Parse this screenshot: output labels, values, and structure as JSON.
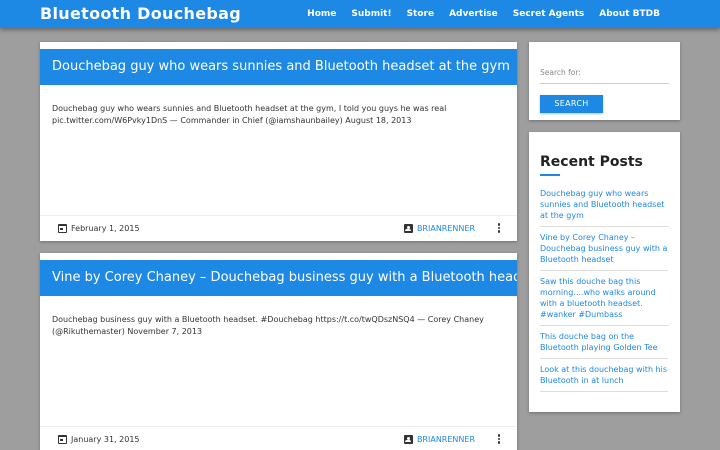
{
  "header": {
    "site_title": "Bluetooth Douchebag",
    "nav": [
      "Home",
      "Submit!",
      "Store",
      "Advertise",
      "Secret Agents",
      "About BTDB"
    ]
  },
  "posts": [
    {
      "title": "Douchebag guy who wears sunnies and Bluetooth headset at the gym",
      "body": "Douchebag guy who wears sunnies and Bluetooth headset at the gym, I told you guys he was real pic.twitter.com/W6Pvky1DnS — Commander in Chief (@iamshaunbailey) August 18, 2013",
      "date": "February 1, 2015",
      "author": "BRIANRENNER"
    },
    {
      "title": "Vine by Corey Chaney – Douchebag business guy with a Bluetooth headset",
      "body": "Douchebag business guy with a Bluetooth headset. #Douchebag https://t.co/twQDszNSQ4 — Corey Chaney (@Rikuthemaster) November 7, 2013",
      "date": "January 31, 2015",
      "author": "BRIANRENNER"
    }
  ],
  "sidebar": {
    "search": {
      "label": "Search for:",
      "button": "SEARCH"
    },
    "recent": {
      "title": "Recent Posts",
      "items": [
        "Douchebag guy who wears sunnies and Bluetooth headset at the gym",
        "Vine by Corey Chaney – Douchebag business guy with a Bluetooth headset",
        "Saw this douche bag this morning....who walks around with a bluetooth headset. #wanker #Dumbass",
        "This douche bag on the Bluetooth playing Golden Tee",
        "Look at this douchebag with his Bluetooth in at lunch"
      ]
    }
  },
  "colors": {
    "accent": "#1e88e5",
    "page_bg": "#9e9e9e"
  }
}
